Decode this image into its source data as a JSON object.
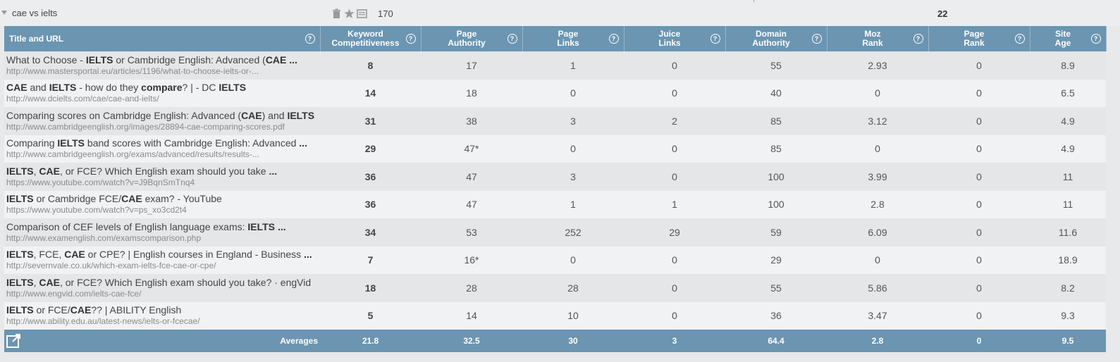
{
  "keyword": "cae vs ielts",
  "search_volume": "170",
  "score": "22",
  "columns": [
    {
      "line1": "Title and URL",
      "line2": ""
    },
    {
      "line1": "Keyword",
      "line2": "Competitiveness"
    },
    {
      "line1": "Page",
      "line2": "Authority"
    },
    {
      "line1": "Page",
      "line2": "Links"
    },
    {
      "line1": "Juice",
      "line2": "Links"
    },
    {
      "line1": "Domain",
      "line2": "Authority"
    },
    {
      "line1": "Moz",
      "line2": "Rank"
    },
    {
      "line1": "Page",
      "line2": "Rank"
    },
    {
      "line1": "Site",
      "line2": "Age"
    }
  ],
  "rows": [
    {
      "title_html": "What to Choose - <b>IELTS</b> or Cambridge English: Advanced (<b>CAE</b> <b>...</b>",
      "url": "http://www.mastersportal.eu/articles/1196/what-to-choose-ielts-or-...",
      "kc": "8",
      "pa": "17",
      "pl": "1",
      "jl": "0",
      "da": "55",
      "mr": "2.93",
      "pr": "0",
      "age": "8.9"
    },
    {
      "title_html": "<b>CAE</b> and <b>IELTS</b> - how do they <b>compare</b>? | - DC <b>IELTS</b>",
      "url": "http://www.dcielts.com/cae/cae-and-ielts/",
      "kc": "14",
      "pa": "18",
      "pl": "0",
      "jl": "0",
      "da": "40",
      "mr": "0",
      "pr": "0",
      "age": "6.5"
    },
    {
      "title_html": "Comparing scores on Cambridge English: Advanced (<b>CAE</b>) and <b>IELTS</b>",
      "url": "http://www.cambridgeenglish.org/images/28894-cae-comparing-scores.pdf",
      "kc": "31",
      "pa": "38",
      "pl": "3",
      "jl": "2",
      "da": "85",
      "mr": "3.12",
      "pr": "0",
      "age": "4.9"
    },
    {
      "title_html": "Comparing <b>IELTS</b> band scores with Cambridge English: Advanced <b>...</b>",
      "url": "http://www.cambridgeenglish.org/exams/advanced/results/results-...",
      "kc": "29",
      "pa": "47*",
      "pl": "0",
      "jl": "0",
      "da": "85",
      "mr": "0",
      "pr": "0",
      "age": "4.9"
    },
    {
      "title_html": "<b>IELTS</b>, <b>CAE</b>, or FCE? Which English exam should you take <b>...</b>",
      "url": "https://www.youtube.com/watch?v=J9BqnSmTnq4",
      "kc": "36",
      "pa": "47",
      "pl": "3",
      "jl": "0",
      "da": "100",
      "mr": "3.99",
      "pr": "0",
      "age": "11"
    },
    {
      "title_html": "<b>IELTS</b> or Cambridge FCE/<b>CAE</b> exam? - YouTube",
      "url": "https://www.youtube.com/watch?v=ps_xo3cd2t4",
      "kc": "36",
      "pa": "47",
      "pl": "1",
      "jl": "1",
      "da": "100",
      "mr": "2.8",
      "pr": "0",
      "age": "11"
    },
    {
      "title_html": "Comparison of CEF levels of English language exams: <b>IELTS</b> <b>...</b>",
      "url": "http://www.examenglish.com/examscomparison.php",
      "kc": "34",
      "pa": "53",
      "pl": "252",
      "jl": "29",
      "da": "59",
      "mr": "6.09",
      "pr": "0",
      "age": "11.6"
    },
    {
      "title_html": "<b>IELTS</b>, FCE, <b>CAE</b> or CPE? | English courses in England - Business <b>...</b>",
      "url": "http://severnvale.co.uk/which-exam-ielts-fce-cae-or-cpe/",
      "kc": "7",
      "pa": "16*",
      "pl": "0",
      "jl": "0",
      "da": "29",
      "mr": "0",
      "pr": "0",
      "age": "18.9"
    },
    {
      "title_html": "<b>IELTS</b>, <b>CAE</b>, or FCE? Which English exam should you take? · engVid",
      "url": "http://www.engvid.com/ielts-cae-fce/",
      "kc": "18",
      "pa": "28",
      "pl": "28",
      "jl": "0",
      "da": "55",
      "mr": "5.86",
      "pr": "0",
      "age": "8.2"
    },
    {
      "title_html": "<b>IELTS</b> or FCE/<b>CAE</b>?? | ABILITY English",
      "url": "http://www.ability.edu.au/latest-news/ielts-or-fcecae/",
      "kc": "5",
      "pa": "14",
      "pl": "10",
      "jl": "0",
      "da": "36",
      "mr": "3.47",
      "pr": "0",
      "age": "9.3"
    }
  ],
  "averages": {
    "label": "Averages",
    "kc": "21.8",
    "pa": "32.5",
    "pl": "30",
    "jl": "3",
    "da": "64.4",
    "mr": "2.8",
    "pr": "0",
    "age": "9.5"
  },
  "help_glyph": "?",
  "icons": [
    "trash-icon",
    "star-icon",
    "notes-icon",
    "help-icon",
    "export-icon",
    "collapse-caret-icon"
  ]
}
